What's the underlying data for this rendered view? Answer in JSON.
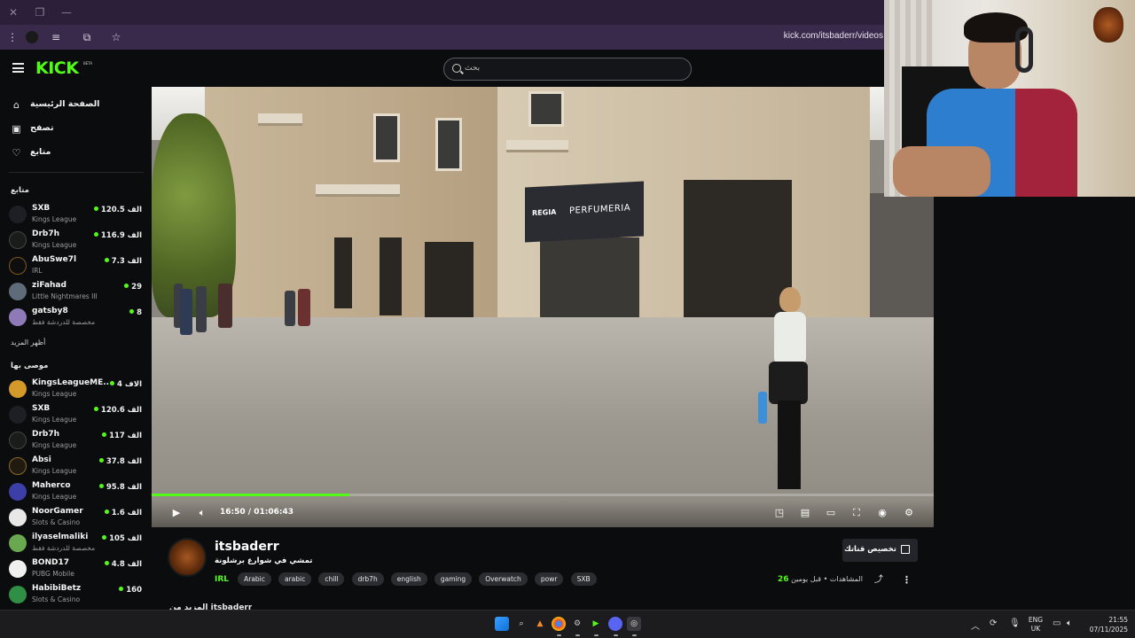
{
  "browser": {
    "url": "kick.com/itsbaderr/videos"
  },
  "header": {
    "logo_text": "KICK",
    "logo_badge": "BETA",
    "search_placeholder": "بحث"
  },
  "sidebar": {
    "nav": [
      {
        "label": "الصفحة الرئيسية",
        "icon": "home-icon"
      },
      {
        "label": "تصفح",
        "icon": "browse-icon"
      },
      {
        "label": "متابع",
        "icon": "heart-icon"
      }
    ],
    "following_title": "متابع",
    "following": [
      {
        "name": "SXB",
        "category": "Kings League",
        "viewers": "120.5 الف"
      },
      {
        "name": "Drb7h",
        "category": "Kings League",
        "viewers": "116.9 الف"
      },
      {
        "name": "AbuSwe7l",
        "category": "IRL",
        "viewers": "7.3 الف"
      },
      {
        "name": "ziFahad",
        "category": "Little Nightmares III",
        "viewers": "29"
      },
      {
        "name": "gatsby8",
        "category": "مخصصة للدردشة فقط",
        "viewers": "8"
      }
    ],
    "show_more": "أظهر المزيد",
    "recommended_title": "موصى بها",
    "recommended": [
      {
        "name": "KingsLeagueME...",
        "category": "Kings League",
        "viewers": "4 الاف"
      },
      {
        "name": "SXB",
        "category": "Kings League",
        "viewers": "120.6 الف"
      },
      {
        "name": "Drb7h",
        "category": "Kings League",
        "viewers": "117 الف"
      },
      {
        "name": "Absi",
        "category": "Kings League",
        "viewers": "37.8 الف"
      },
      {
        "name": "Maherco",
        "category": "Kings League",
        "viewers": "95.8 الف"
      },
      {
        "name": "NoorGamer",
        "category": "Slots & Casino",
        "viewers": "1.6 الف"
      },
      {
        "name": "ilyaselmaliki",
        "category": "مخصصة للدردشة فقط",
        "viewers": "105 الف"
      },
      {
        "name": "BOND17",
        "category": "PUBG Mobile",
        "viewers": "4.8 الف"
      },
      {
        "name": "HabibiBetz",
        "category": "Slots & Casino",
        "viewers": "160"
      }
    ]
  },
  "video": {
    "sign_brand": "REGIA",
    "sign_text": "PERFUMERIA",
    "current_time": "16:50",
    "duration": "01:06:43",
    "progress_fraction": 0.253
  },
  "info": {
    "channel_name": "itsbaderr",
    "title": "تمشي في شوارع برشلونة",
    "category": "IRL",
    "tags": [
      "Arabic",
      "arabic",
      "chill",
      "drb7h",
      "english",
      "gaming",
      "Overwatch",
      "powr",
      "SXB"
    ],
    "clip_label": "تخصيص قناتك",
    "views_label": "المشاهدات",
    "views_count": "26",
    "age": "قبل يومين",
    "separator": "•",
    "below_text": "المزيد من itsbaderr"
  },
  "taskbar": {
    "lang_1": "ENG",
    "lang_2": "UK",
    "time": "21:55",
    "date": "07/11/2025"
  },
  "colors": {
    "accent": "#53fc18",
    "bg": "#0b0c0e",
    "browser_bar": "#392a4c"
  }
}
